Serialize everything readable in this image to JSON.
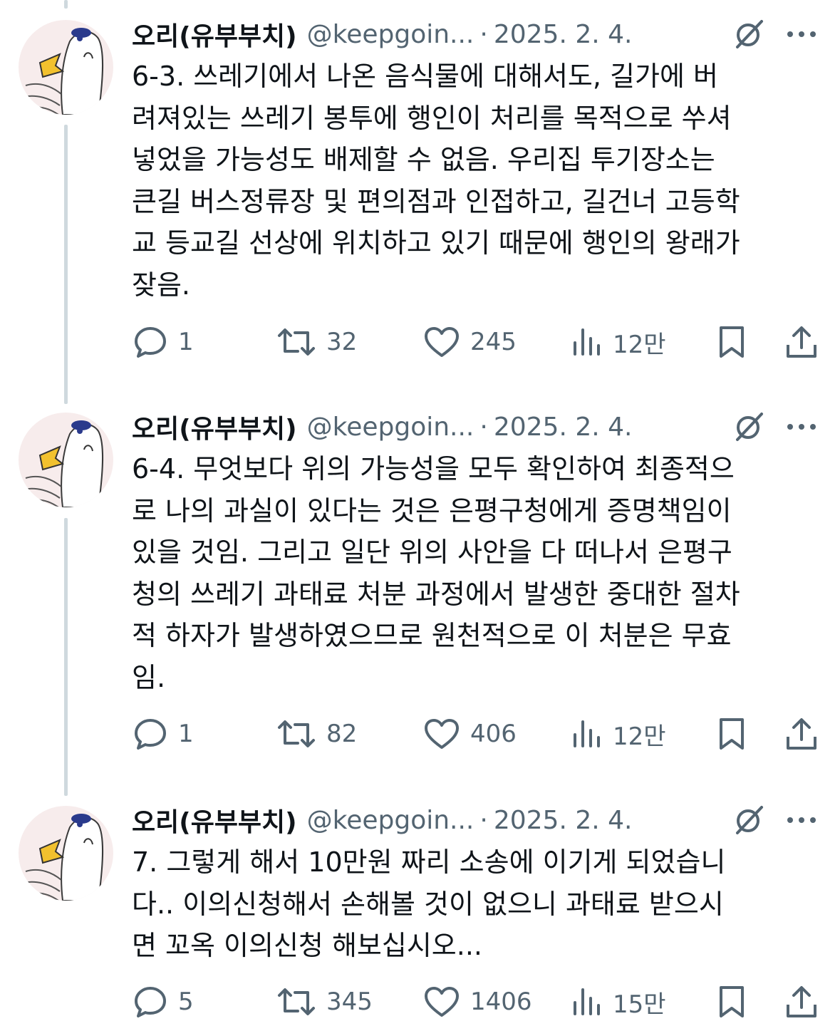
{
  "tweets": [
    {
      "author_name": "오리(유부부치)",
      "handle": "@keepgoin...",
      "separator": "·",
      "date": "2025. 2. 4.",
      "lines": [
        "6-3. 쓰레기에서 나온 음식물에 대해서도, 길가에 버",
        "려져있는 쓰레기 봉투에 행인이 처리를 목적으로 쑤셔",
        "넣었을 가능성도 배제할 수 없음. 우리집 투기장소는",
        "큰길 버스정류장 및 편의점과 인접하고, 길건너 고등학",
        "교 등교길 선상에 위치하고 있기 때문에 행인의 왕래가",
        "잦음."
      ],
      "stats": {
        "replies": "1",
        "reposts": "32",
        "likes": "245",
        "views": "12만"
      }
    },
    {
      "author_name": "오리(유부부치)",
      "handle": "@keepgoin...",
      "separator": "·",
      "date": "2025. 2. 4.",
      "lines": [
        "6-4. 무엇보다 위의 가능성을 모두 확인하여 최종적으",
        "로 나의 과실이 있다는 것은 은평구청에게 증명책임이",
        "있을 것임. 그리고 일단 위의 사안을 다 떠나서 은평구",
        "청의 쓰레기 과태료 처분 과정에서 발생한 중대한 절차",
        "적 하자가 발생하였으므로 원천적으로 이 처분은 무효",
        "임."
      ],
      "stats": {
        "replies": "1",
        "reposts": "82",
        "likes": "406",
        "views": "12만"
      }
    },
    {
      "author_name": "오리(유부부치)",
      "handle": "@keepgoin...",
      "separator": "·",
      "date": "2025. 2. 4.",
      "lines": [
        "7. 그렇게 해서 10만원 짜리 소송에 이기게 되었습니",
        "다.. 이의신청해서 손해볼 것이 없으니 과태료 받으시",
        "면 꼬옥 이의신청 해보십시오..."
      ],
      "stats": {
        "replies": "5",
        "reposts": "345",
        "likes": "1406",
        "views": "15만"
      }
    }
  ],
  "icons": {
    "reply": "speech-bubble-icon",
    "repost": "repost-arrows-icon",
    "like": "heart-icon",
    "views": "bar-chart-icon",
    "bookmark": "bookmark-icon",
    "share": "share-upload-icon",
    "grok": "grok-slash-circle-icon",
    "more": "three-dots-icon"
  },
  "colors": {
    "text_primary": "#0f1419",
    "text_secondary": "#536471",
    "thread_line": "#cfd9de"
  }
}
